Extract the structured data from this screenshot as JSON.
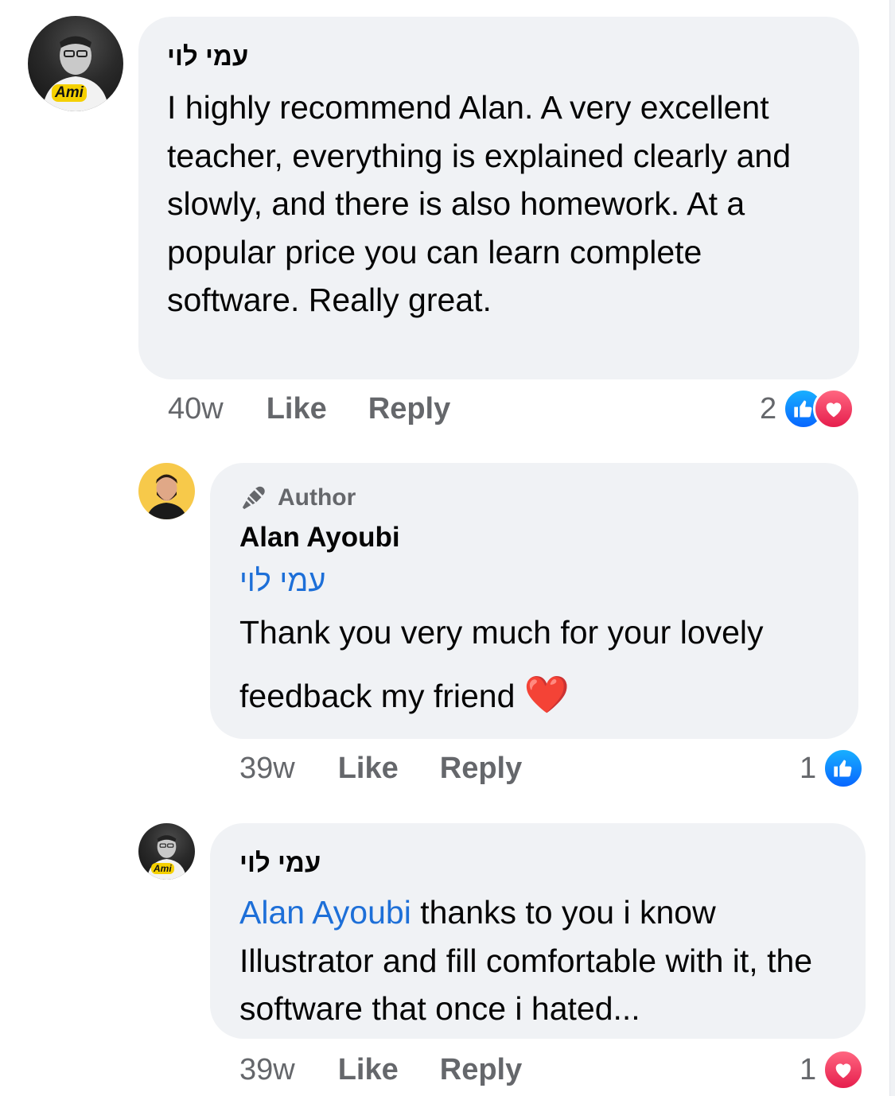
{
  "comments": [
    {
      "author": "עמי לוי",
      "avatar_text": "Ami",
      "text": "I highly recommend Alan. A very excellent teacher, everything is explained clearly and slowly, and there is also homework. At a popular price you can learn complete software. Really great.",
      "time": "40w",
      "like_label": "Like",
      "reply_label": "Reply",
      "reaction_count": "2",
      "reactions": [
        "like-icon",
        "love-icon"
      ]
    },
    {
      "badge": "Author",
      "author": "Alan Ayoubi",
      "mention": "עמי לוי",
      "text": "Thank you very much for your lovely feedback my friend",
      "emoji": "❤️",
      "time": "39w",
      "like_label": "Like",
      "reply_label": "Reply",
      "reaction_count": "1",
      "reactions": [
        "like-icon"
      ]
    },
    {
      "author": "עמי לוי",
      "avatar_text": "Ami",
      "mention": "Alan Ayoubi",
      "text": "thanks to you i know Illustrator and fill comfortable with it, the software that once i hated...",
      "time": "39w",
      "like_label": "Like",
      "reply_label": "Reply",
      "reaction_count": "1",
      "reactions": [
        "love-icon"
      ]
    }
  ],
  "colors": {
    "bubble": "#f0f2f5",
    "mention": "#1d6fd8",
    "meta": "#65676b",
    "like": "#0866ff",
    "love": "#e61e4d"
  }
}
